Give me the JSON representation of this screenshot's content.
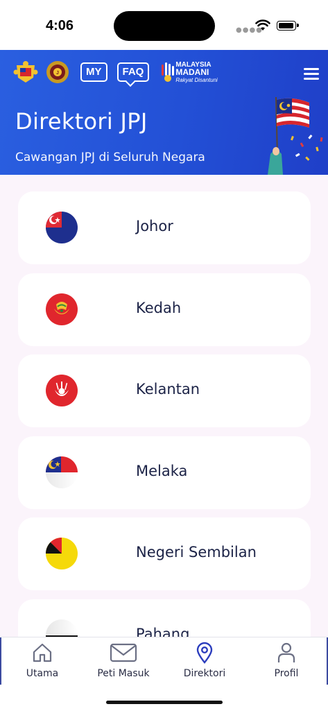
{
  "status": {
    "time": "4:06"
  },
  "header": {
    "title": "Direktori JPJ",
    "subtitle": "Cawangan JPJ di Seluruh Negara",
    "logos": {
      "my": "MY",
      "faq": "FAQ",
      "madani_l1": "MALAYSIA",
      "madani_l2": "MADANI",
      "madani_l3": "Rakyat Disantuni"
    },
    "accent": "#2458dc"
  },
  "states": [
    {
      "label": "Johor",
      "icon": "johor-flag-icon"
    },
    {
      "label": "Kedah",
      "icon": "kedah-flag-icon"
    },
    {
      "label": "Kelantan",
      "icon": "kelantan-flag-icon"
    },
    {
      "label": "Melaka",
      "icon": "melaka-flag-icon"
    },
    {
      "label": "Negeri Sembilan",
      "icon": "negeri-sembilan-flag-icon"
    },
    {
      "label": "Pahang",
      "icon": "pahang-flag-icon"
    }
  ],
  "tabs": [
    {
      "label": "Utama",
      "icon": "home-icon"
    },
    {
      "label": "Peti Masuk",
      "icon": "mail-icon"
    },
    {
      "label": "Direktori",
      "icon": "location-pin-icon",
      "active": true
    },
    {
      "label": "Profil",
      "icon": "person-icon"
    }
  ]
}
